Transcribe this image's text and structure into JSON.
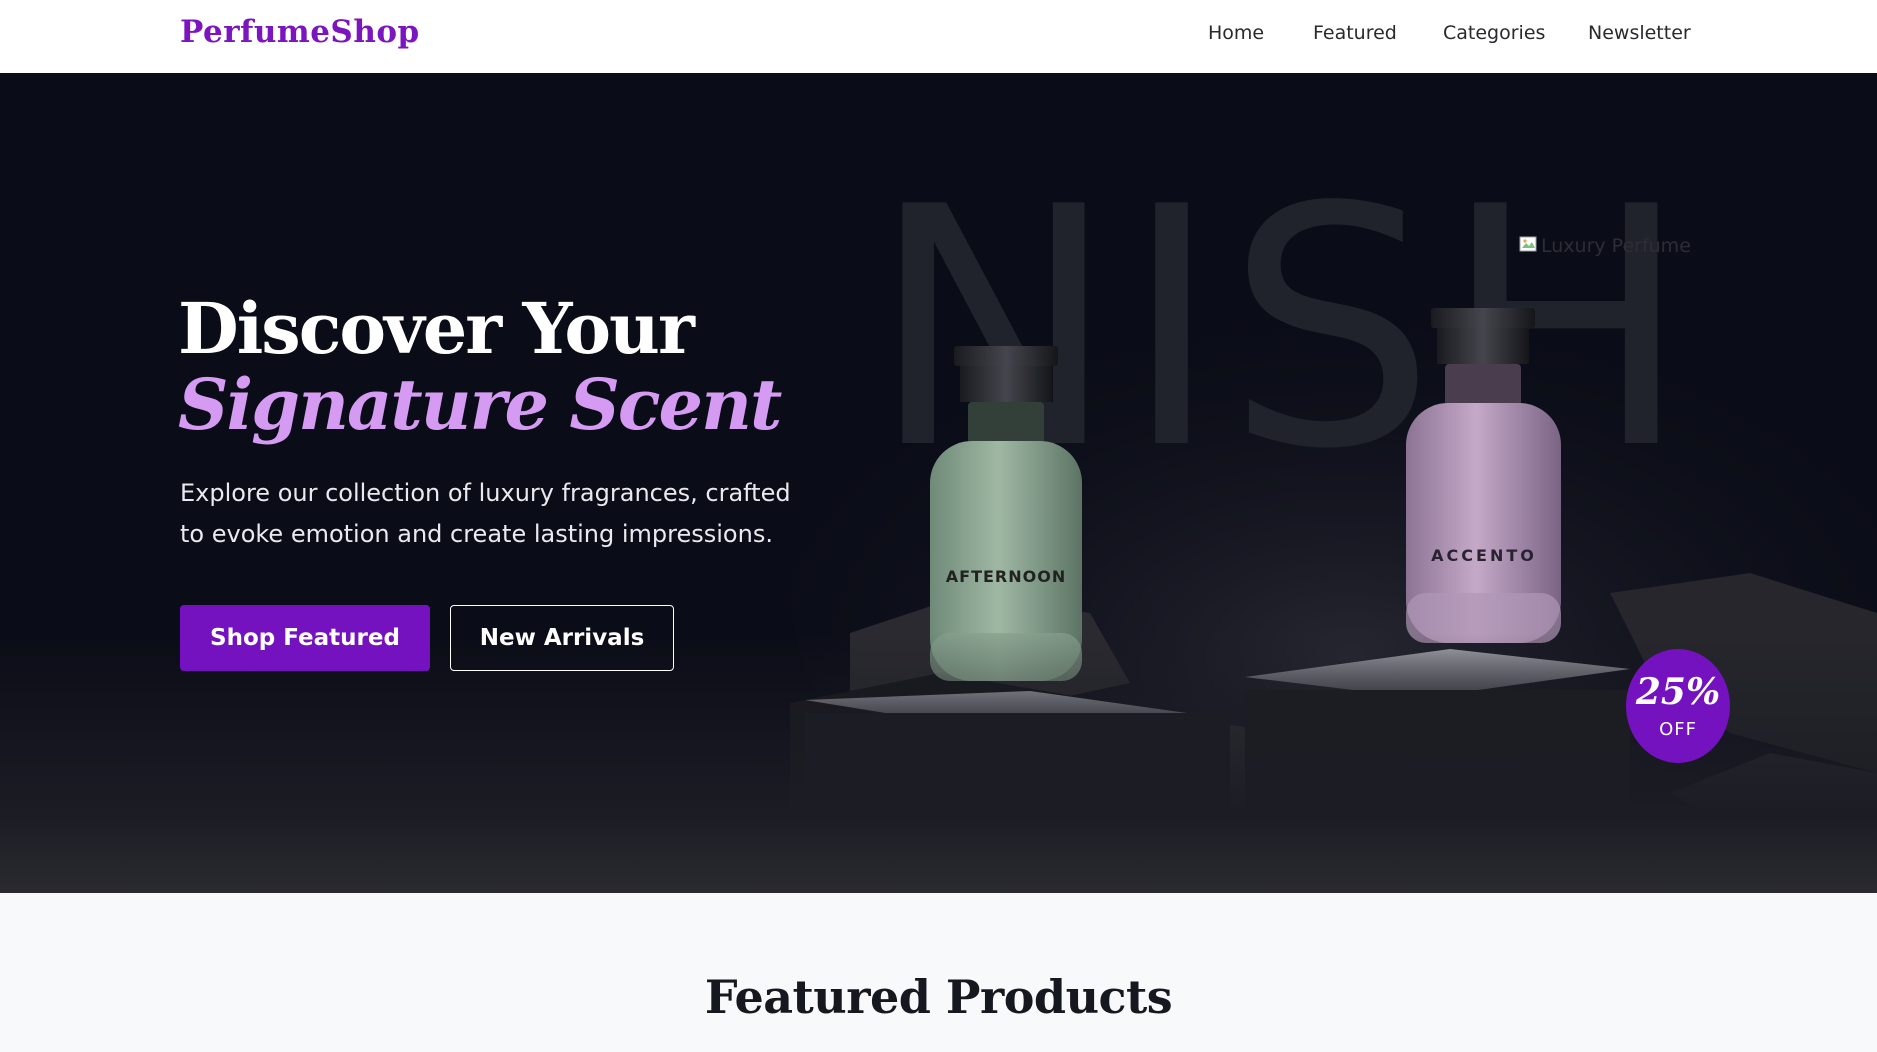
{
  "brand": {
    "name": "PerfumeShop"
  },
  "nav": {
    "links": [
      "Home",
      "Featured",
      "Categories",
      "Newsletter"
    ]
  },
  "hero": {
    "title_line1": "Discover Your",
    "title_line2": "Signature Scent",
    "description": "Explore our collection of luxury fragrances, crafted to evoke emotion and create lasting impressions.",
    "primary_button": "Shop Featured",
    "secondary_button": "New Arrivals",
    "image_alt": "Luxury Perfume",
    "image_text": {
      "backdrop_word": "NISH",
      "bottle_left_label": "AFTERNOON",
      "bottle_right_label": "ACCENTO"
    },
    "badge": {
      "value": "25%",
      "label": "OFF"
    }
  },
  "featured": {
    "title": "Featured Products"
  },
  "colors": {
    "brand": "#7b16bf",
    "primary_button": "#7412bf",
    "accent_text": "#d59bf2",
    "hero_bg": "#0a0c17",
    "section_bg": "#f8f9fb"
  },
  "icons": [
    "broken-image-icon"
  ]
}
